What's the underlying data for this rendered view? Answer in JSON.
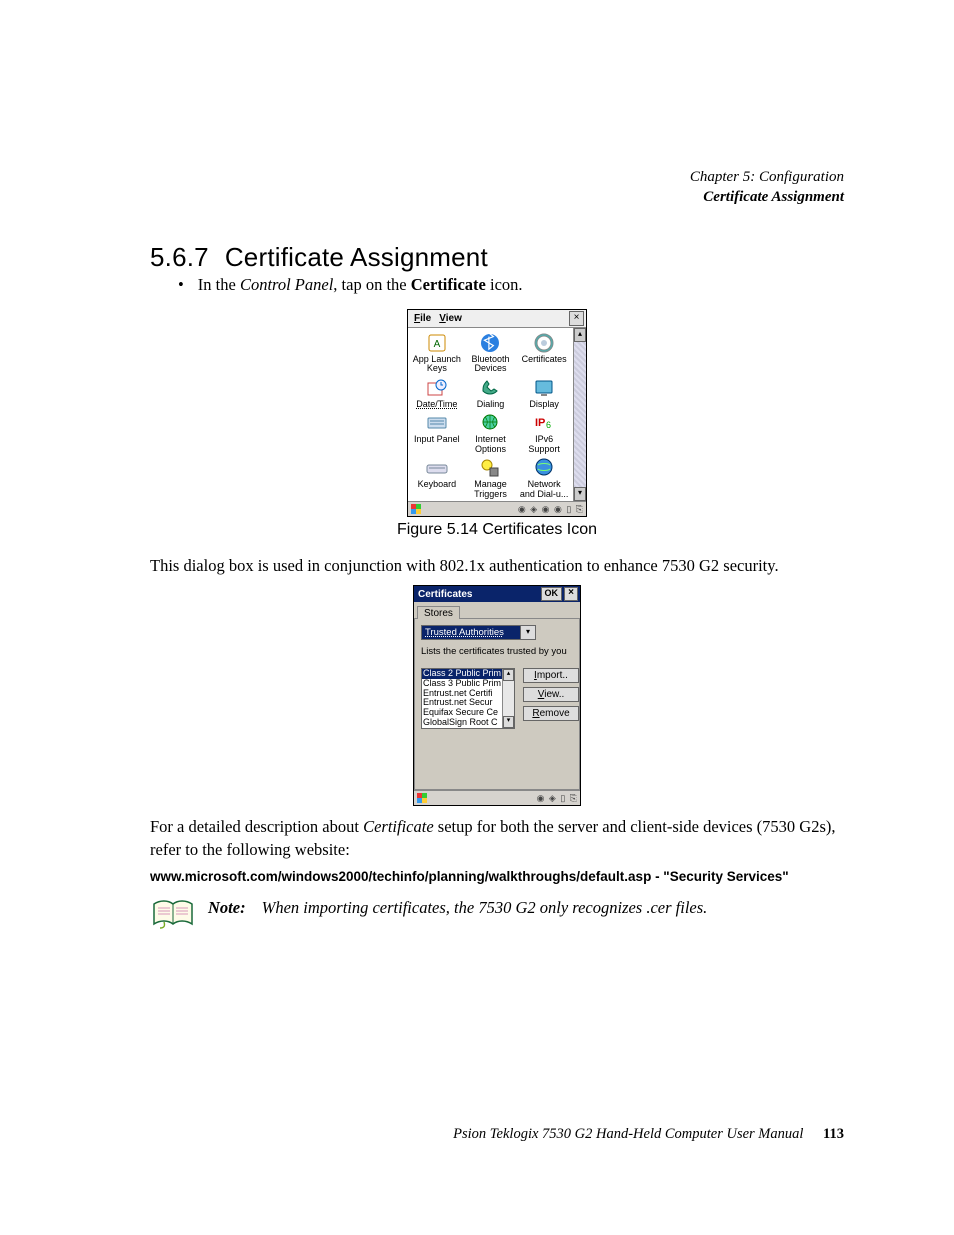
{
  "header": {
    "chapter": "Chapter 5: Configuration",
    "section": "Certificate Assignment"
  },
  "heading": {
    "number": "5.6.7",
    "title": "Certificate Assignment"
  },
  "bullet": {
    "pre": "In the ",
    "cp": "Control Panel",
    "mid": ", tap on the ",
    "cert": "Certificate",
    "post": " icon."
  },
  "control_panel": {
    "menu_file": "File",
    "menu_view": "View",
    "close": "×",
    "scroll_up": "▴",
    "scroll_down": "▾",
    "items": [
      {
        "l1": "App Launch",
        "l2": "Keys"
      },
      {
        "l1": "Bluetooth",
        "l2": "Devices"
      },
      {
        "l1": "Certificates",
        "l2": ""
      },
      {
        "l1": "Date/Time",
        "l2": ""
      },
      {
        "l1": "Dialing",
        "l2": ""
      },
      {
        "l1": "Display",
        "l2": ""
      },
      {
        "l1": "Input Panel",
        "l2": ""
      },
      {
        "l1": "Internet",
        "l2": "Options"
      },
      {
        "l1": "IPv6",
        "l2": "Support"
      },
      {
        "l1": "Keyboard",
        "l2": ""
      },
      {
        "l1": "Manage",
        "l2": "Triggers"
      },
      {
        "l1": "Network",
        "l2": "and Dial-u..."
      }
    ],
    "tray": "◉ ◈ ◉ ◉ ▯ ⎘"
  },
  "figure_caption": "Figure 5.14 Certificates Icon",
  "para1": "This dialog box is used in conjunction with 802.1x authentication to enhance 7530 G2 security.",
  "dialog": {
    "title": "Certificates",
    "ok": "OK",
    "close": "×",
    "tab": "Stores",
    "combo_value": "Trusted Authorities",
    "combo_dd": "▾",
    "desc": "Lists the certificates trusted by you",
    "cert_rows": [
      "Class 2 Public Prim",
      "Class 3 Public Prim",
      "Entrust.net Certifi",
      "Entrust.net Secur",
      "Equifax Secure Ce",
      "GlobalSign Root C"
    ],
    "scroll_up": "▴",
    "scroll_down": "▾",
    "btn_import": "Import..",
    "btn_view": "View..",
    "btn_remove": "Remove",
    "tray": "◉ ◈ ▯ ⎘"
  },
  "para2_a": "For a detailed description about ",
  "para2_em": "Certificate",
  "para2_b": " setup for both the server and client-side devices (7530 G2s), refer to the following website:",
  "link": "www.microsoft.com/windows2000/techinfo/planning/walkthroughs/default.asp - \"Security Services\"",
  "note": {
    "label": "Note:",
    "text": "When importing certificates, the 7530 G2 only recognizes .cer files."
  },
  "footer": {
    "text": "Psion Teklogix 7530 G2 Hand-Held Computer User Manual",
    "page": "113"
  }
}
